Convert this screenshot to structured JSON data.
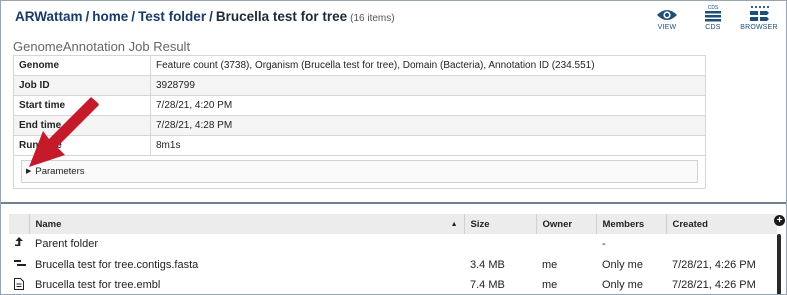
{
  "breadcrumb": {
    "user": "ARWattam",
    "sep1": "/",
    "home": "home",
    "sep2": "/",
    "folder": "Test folder",
    "sep3": "/",
    "current": "Brucella test for tree",
    "count": "(16 items)"
  },
  "toolbar": [
    {
      "label": "VIEW",
      "icon": "eye-icon"
    },
    {
      "label": "CDS",
      "icon": "cds-icon",
      "icon_text": "CDS"
    },
    {
      "label": "BROWSER",
      "icon": "genome-browser-icon"
    }
  ],
  "job": {
    "title": "GenomeAnnotation Job Result",
    "rows": [
      {
        "key": "Genome",
        "value": "Feature count (3738), Organism (Brucella test for tree), Domain (Bacteria), Annotation ID (234.551)"
      },
      {
        "key": "Job ID",
        "value": "3928799"
      },
      {
        "key": "Start time",
        "value": "7/28/21, 4:20 PM"
      },
      {
        "key": "End time",
        "value": "7/28/21, 4:28 PM"
      },
      {
        "key": "Run time",
        "value": "8m1s"
      }
    ],
    "parameters_label": "Parameters"
  },
  "annotation": {
    "arrow_color": "#c41a2a"
  },
  "files": {
    "columns": [
      "Name",
      "Size",
      "Owner",
      "Members",
      "Created"
    ],
    "rows": [
      {
        "icon": "up-arrow-icon",
        "name": "Parent folder",
        "size": "",
        "owner": "",
        "members": "-",
        "created": ""
      },
      {
        "icon": "contigs-icon",
        "name": "Brucella test for tree.contigs.fasta",
        "size": "3.4 MB",
        "owner": "me",
        "members": "Only me",
        "created": "7/28/21, 4:26 PM"
      },
      {
        "icon": "document-icon",
        "name": "Brucella test for tree.embl",
        "size": "7.4 MB",
        "owner": "me",
        "members": "Only me",
        "created": "7/28/21, 4:26 PM"
      }
    ]
  },
  "colors": {
    "link": "#1a3a66",
    "toolbar_icon": "#1f4e79",
    "divider": "#6f8294"
  }
}
